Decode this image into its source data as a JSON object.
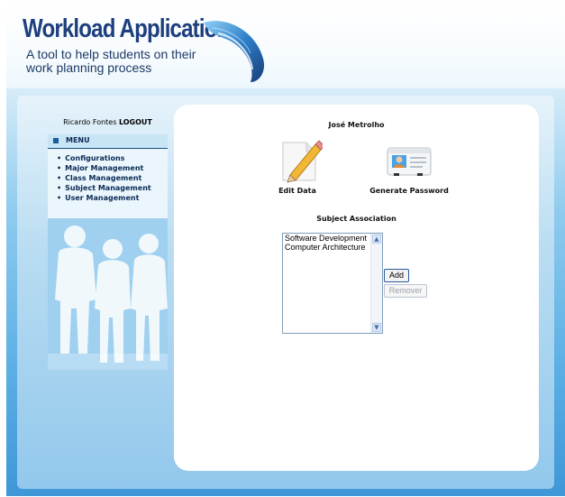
{
  "header": {
    "title": "Workload Application",
    "tagline": "A tool to help students on their work planning process"
  },
  "sidebar": {
    "user_name": "Ricardo Fontes",
    "logout_label": "LOGOUT",
    "menu_label": "MENU",
    "items": [
      {
        "label": "Configurations"
      },
      {
        "label": "Major Management"
      },
      {
        "label": "Class Management"
      },
      {
        "label": "Subject Management"
      },
      {
        "label": "User Management"
      }
    ]
  },
  "main": {
    "person_name": "José Metrolho",
    "edit_label": "Edit Data",
    "generate_label": "Generate Password",
    "association_title": "Subject Association",
    "subjects": [
      "Software Development",
      "Computer Architecture"
    ],
    "add_label": "Add",
    "remove_label": "Remover"
  },
  "icons": {
    "edit": "pencil-paper-icon",
    "generate": "id-card-icon",
    "logo": "swoosh-logo-icon"
  },
  "colors": {
    "title": "#1d3f7e",
    "frame_blue": "#5aaee4",
    "menu_text": "#0b2a55"
  }
}
